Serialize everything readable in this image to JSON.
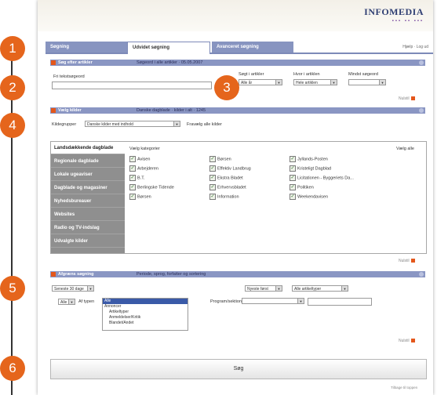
{
  "header": {
    "brand": "INFOMEDIA",
    "brand_dots": "▪▪▪ ▪▪ ▪▪▪",
    "top_links": "Hjælp · Log ud"
  },
  "tabs": [
    {
      "label": "Søgning"
    },
    {
      "label": "Udvidet søgning"
    },
    {
      "label": "Avanceret søgning"
    }
  ],
  "badges": [
    "1",
    "2",
    "3",
    "4",
    "5",
    "6"
  ],
  "section1": {
    "title": "Søg efter artikler",
    "subtitle": "Søgeord i alle artikler · 05.05.2007",
    "free_text_label": "Fri tekstsøgeord",
    "filter_labels": [
      "Søgt i artikler",
      "Hvor i artiklen",
      "Mindst søgeord"
    ],
    "filter_values": [
      "Alle år",
      "Hele artiklen",
      ""
    ],
    "reset_label": "Nulstil"
  },
  "section2": {
    "title": "Vælg kilder",
    "subtitle": "Danske dagblade · kilder i alt · 1245",
    "group_label": "Kildegrupper",
    "group_value": "Danske kilder med indhold",
    "all_label": "Fravælg alle kilder",
    "categories": [
      "Landsdækkende dagblade",
      "Regionale dagblade",
      "Lokale ugeaviser",
      "Dagblade og magasiner",
      "Nyhedsbureauer",
      "Websites",
      "Radio og TV-indslag",
      "Udvalgte kilder"
    ],
    "pick_label": "Vælg kategorier",
    "pick_all": "Vælg alle",
    "checkboxes": [
      [
        "Avisen",
        "Børsen",
        "Jyllands-Posten"
      ],
      [
        "Arbejderen",
        "Effektiv Landbrug",
        "Kristeligt Dagblad"
      ],
      [
        "B.T.",
        "Ekstra Bladet",
        "Licitationen - Byggeriets Da..."
      ],
      [
        "Berlingske Tidende",
        "Erhvervsbladet",
        "Politiken"
      ],
      [
        "Børsen",
        "Information",
        "Weekendavisen"
      ]
    ],
    "reset_label": "Nulstil"
  },
  "section3": {
    "title": "Afgræns søgning",
    "subtitle": "Periode, sprog, forfatter og sortering",
    "period_value": "Seneste 30 dage",
    "sort_value": "Nyeste først",
    "type_value": "Alle artikeltyper",
    "lang_value": "Alle",
    "author_label": "Af typen",
    "list_items": [
      "Alle",
      "Annoncer",
      "Artikeltyper",
      "Anmeldelser/Kritik",
      "Blandet/Andet"
    ],
    "program_label": "Program/sektion",
    "reset_label": "Nulstil"
  },
  "search_button": "Søg",
  "footer_link": "Tilbage til toppen"
}
